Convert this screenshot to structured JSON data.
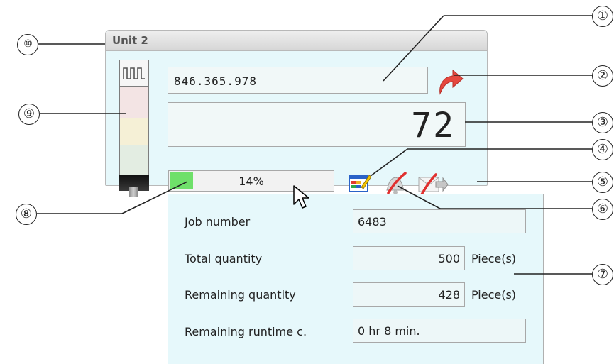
{
  "panel": {
    "title": "Unit 2"
  },
  "serial_number": "846.365.978",
  "counter": "72",
  "progress": {
    "percent": 14,
    "label": "14%"
  },
  "job": {
    "rows": [
      {
        "label": "Job number",
        "value": "6483",
        "unit": ""
      },
      {
        "label": "Total quantity",
        "value": "500",
        "unit": "Piece(s)"
      },
      {
        "label": "Remaining quantity",
        "value": "428",
        "unit": "Piece(s)"
      },
      {
        "label": "Remaining runtime  c.",
        "value": "0 hr 8 min.",
        "unit": ""
      }
    ]
  },
  "callouts": [
    "①",
    "②",
    "③",
    "④",
    "⑤",
    "⑥",
    "⑦",
    "⑧",
    "⑨",
    "⑩"
  ],
  "icons": {
    "tower_top": "square-wave-icon",
    "forward": "curved-arrow-icon",
    "edit": "form-edit-icon",
    "bell": "bell-disabled-icon",
    "mail": "mail-disabled-icon"
  },
  "colors": {
    "panel_bg": "#e6f8fb",
    "progress_fill": "#6fe06a",
    "arrow": "#e5483f",
    "strike": "#e0302f"
  }
}
